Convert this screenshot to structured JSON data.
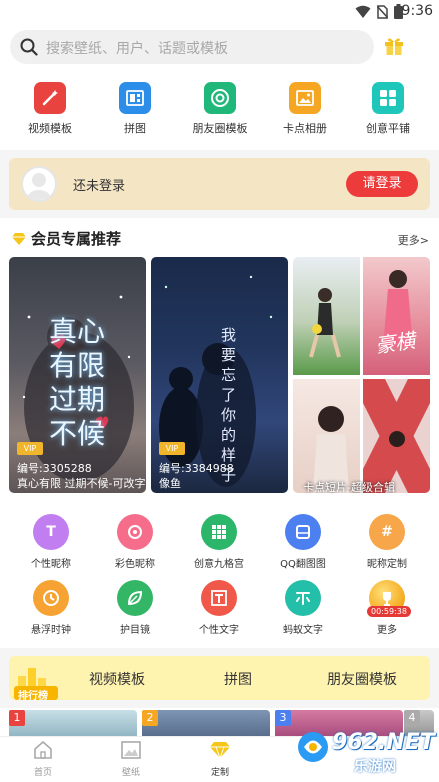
{
  "status_bar": {
    "time": "9:36"
  },
  "search": {
    "placeholder": "搜索壁纸、用户、话题或模板"
  },
  "categories": [
    {
      "label": "视频模板",
      "icon": "magic-wand-icon",
      "color": "#e9433f"
    },
    {
      "label": "拼图",
      "icon": "puzzle-icon",
      "color": "#2c8ee8"
    },
    {
      "label": "朋友圈模板",
      "icon": "moments-icon",
      "color": "#1fb87a"
    },
    {
      "label": "卡点相册",
      "icon": "photo-album-icon",
      "color": "#f5a623"
    },
    {
      "label": "创意平铺",
      "icon": "grid-icon",
      "color": "#1ec7b9"
    }
  ],
  "login": {
    "status": "还未登录",
    "button": "请登录"
  },
  "vip_section": {
    "title": "会员专属推荐",
    "more": "更多>",
    "cards": [
      {
        "badge": "VIP",
        "number": "编号:3305288",
        "name": "真心有限 过期不候-可改字",
        "overlay_text": "真心有限过期不候"
      },
      {
        "badge": "VIP",
        "number": "编号:3384988",
        "name": "像鱼",
        "overlay_text": "我要忘了你的样子"
      }
    ],
    "grid_caption": "卡点短片-超级合辑",
    "grid_overlay": "豪横"
  },
  "features": [
    {
      "label": "个性昵称",
      "icon": "T-icon",
      "color": "#c07ef0"
    },
    {
      "label": "彩色昵称",
      "icon": "color-palette-icon",
      "color": "#f56d8a"
    },
    {
      "label": "创意九格宫",
      "icon": "nine-grid-icon",
      "color": "#2cb66a"
    },
    {
      "label": "QQ翻图图",
      "icon": "flip-image-icon",
      "color": "#4c7ff0"
    },
    {
      "label": "昵称定制",
      "icon": "hash-icon",
      "color": "#f7a64a"
    },
    {
      "label": "悬浮时钟",
      "icon": "clock-icon",
      "color": "#f6a334"
    },
    {
      "label": "护目镜",
      "icon": "leaf-icon",
      "color": "#33b665"
    },
    {
      "label": "个性文字",
      "icon": "text-frame-icon",
      "color": "#f0584a"
    },
    {
      "label": "蚂蚁文字",
      "icon": "ant-text-icon",
      "color": "#24bfa8"
    },
    {
      "label": "更多",
      "icon": "trophy-icon",
      "color": "#f4a81c"
    }
  ],
  "more_timer": "00:59:38",
  "ranking": {
    "badge": "排行榜",
    "tabs": [
      "视频模板",
      "拼图",
      "朋友圈模板"
    ],
    "item_numbers": [
      "1",
      "2",
      "3",
      "4"
    ]
  },
  "bottom_nav": [
    {
      "label": "首页",
      "icon": "home-icon"
    },
    {
      "label": "壁纸",
      "icon": "wallpaper-icon"
    },
    {
      "label": "定制",
      "icon": "diamond-icon"
    }
  ],
  "watermark": {
    "brand": "962.NET",
    "sub": "乐游网"
  }
}
